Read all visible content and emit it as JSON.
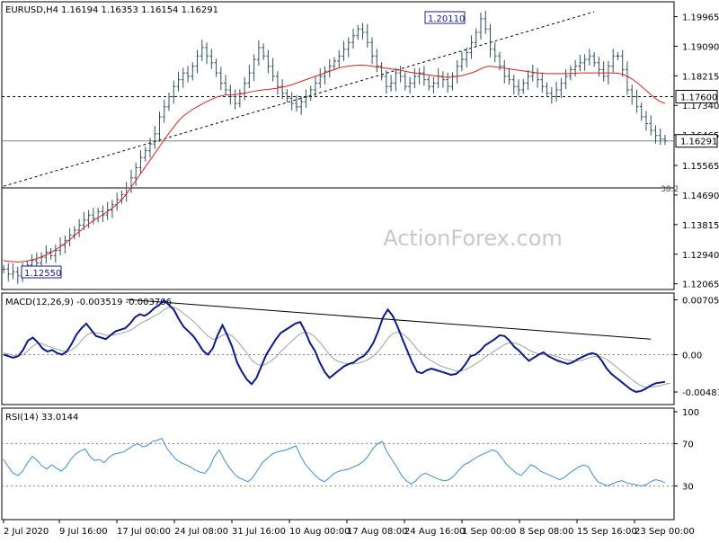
{
  "header": {
    "symbol": "EURUSD,H4",
    "ohlc": "1.16194 1.16353 1.16154 1.16291"
  },
  "watermark": "ActionForex.com",
  "colors": {
    "price_bars": "#2f4f5f",
    "ma": "#e0201b",
    "macd": "#0b1a8a",
    "signal": "#a0a0a0",
    "rsi": "#3a8ed6",
    "label_border": "#1a1a9a",
    "grid": "#808080"
  },
  "annotations": {
    "high_label": "1.20110",
    "low_label": "1.12550",
    "fib_label": "38.2"
  },
  "chart_data": [
    {
      "type": "ohlc",
      "panel": "price",
      "y_ticks": [
        "1.19965",
        "1.19090",
        "1.18215",
        "1.17340",
        "1.16465",
        "1.15565",
        "1.14690",
        "1.13815",
        "1.12940",
        "1.12065"
      ],
      "ylim": [
        1.1195,
        1.2035
      ],
      "highlight_labels": [
        {
          "text": "1.17600",
          "value": 1.176
        },
        {
          "text": "1.16291",
          "value": 1.16291
        }
      ],
      "horizontal_lines": [
        {
          "value": 1.176,
          "style": "dashed"
        },
        {
          "value": 1.16291,
          "style": "solid-gray"
        },
        {
          "value": 1.149,
          "style": "solid",
          "label": "38.2"
        }
      ],
      "trendline": {
        "from": [
          0,
          1.1495
        ],
        "to": [
          125,
          1.2011
        ],
        "style": "dashed"
      },
      "closes": [
        1.125,
        1.1235,
        1.1242,
        1.123,
        1.1248,
        1.1262,
        1.1275,
        1.1268,
        1.1285,
        1.13,
        1.129,
        1.1305,
        1.132,
        1.1335,
        1.135,
        1.1365,
        1.138,
        1.1395,
        1.141,
        1.14,
        1.142,
        1.141,
        1.1425,
        1.144,
        1.1455,
        1.147,
        1.149,
        1.152,
        1.155,
        1.158,
        1.16,
        1.162,
        1.165,
        1.17,
        1.173,
        1.176,
        1.179,
        1.181,
        1.183,
        1.182,
        1.185,
        1.188,
        1.1905,
        1.188,
        1.186,
        1.183,
        1.18,
        1.178,
        1.176,
        1.174,
        1.177,
        1.18,
        1.183,
        1.187,
        1.1905,
        1.188,
        1.185,
        1.182,
        1.179,
        1.177,
        1.1755,
        1.174,
        1.173,
        1.1745,
        1.176,
        1.178,
        1.18,
        1.182,
        1.1835,
        1.185,
        1.1865,
        1.188,
        1.19,
        1.192,
        1.194,
        1.196,
        1.195,
        1.192,
        1.188,
        1.185,
        1.182,
        1.179,
        1.18,
        1.183,
        1.182,
        1.179,
        1.18,
        1.182,
        1.183,
        1.181,
        1.179,
        1.18,
        1.182,
        1.181,
        1.179,
        1.182,
        1.185,
        1.187,
        1.189,
        1.192,
        1.195,
        1.199,
        1.196,
        1.19,
        1.188,
        1.185,
        1.182,
        1.181,
        1.179,
        1.178,
        1.18,
        1.182,
        1.183,
        1.181,
        1.179,
        1.177,
        1.176,
        1.178,
        1.18,
        1.182,
        1.184,
        1.185,
        1.186,
        1.187,
        1.188,
        1.186,
        1.184,
        1.182,
        1.185,
        1.188,
        1.188,
        1.184,
        1.178,
        1.176,
        1.173,
        1.17,
        1.168,
        1.166,
        1.1645,
        1.1635,
        1.1629
      ],
      "ma_closes": [
        1.1275,
        1.1273,
        1.1272,
        1.1271,
        1.1272,
        1.1274,
        1.1277,
        1.1281,
        1.1286,
        1.1292,
        1.1299,
        1.1307,
        1.1316,
        1.1326,
        1.1337,
        1.1349,
        1.1361,
        1.1372,
        1.1383,
        1.1393,
        1.1402,
        1.1411,
        1.142,
        1.143,
        1.1441,
        1.1455,
        1.1472,
        1.1492,
        1.1512,
        1.1532,
        1.1552,
        1.1572,
        1.1592,
        1.1612,
        1.1632,
        1.1652,
        1.167,
        1.1688,
        1.1702,
        1.1712,
        1.1722,
        1.173,
        1.1738,
        1.1745,
        1.1752,
        1.1758,
        1.1762,
        1.1765,
        1.1765,
        1.1766,
        1.1768,
        1.177,
        1.1773,
        1.1776,
        1.1778,
        1.178,
        1.1781,
        1.1783,
        1.1785,
        1.1788,
        1.1791,
        1.1795,
        1.18,
        1.1805,
        1.181,
        1.1815,
        1.182,
        1.1825,
        1.183,
        1.1835,
        1.184,
        1.1845,
        1.1848,
        1.185,
        1.1852,
        1.1853,
        1.1853,
        1.1852,
        1.185,
        1.1848,
        1.1846,
        1.1844,
        1.1842,
        1.184,
        1.1838,
        1.1835,
        1.1832,
        1.183,
        1.1828,
        1.1826,
        1.1824,
        1.1822,
        1.182,
        1.1818,
        1.1817,
        1.1818,
        1.182,
        1.1822,
        1.1826,
        1.183,
        1.1835,
        1.1842,
        1.1848,
        1.185,
        1.1848,
        1.1846,
        1.1844,
        1.1842,
        1.184,
        1.1838,
        1.1836,
        1.1834,
        1.1832,
        1.183,
        1.1829,
        1.1828,
        1.1828,
        1.1828,
        1.1828,
        1.1828,
        1.1828,
        1.1829,
        1.183,
        1.183,
        1.183,
        1.183,
        1.183,
        1.183,
        1.183,
        1.183,
        1.1829,
        1.1826,
        1.182,
        1.1812,
        1.1802,
        1.179,
        1.1778,
        1.1766,
        1.1754,
        1.1745,
        1.174
      ]
    },
    {
      "type": "line",
      "panel": "macd",
      "title": "MACD(12,26,9) -0.003519 -0.003706",
      "y_ticks": [
        {
          "text": "0.007057",
          "value": 0.007057
        },
        {
          "text": "0.00",
          "value": 0.0
        },
        {
          "text": "-0.004818",
          "value": -0.004818
        }
      ],
      "ylim": [
        -0.0062,
        0.0077
      ],
      "trendline": {
        "from": [
          26,
          0.0071
        ],
        "to": [
          137,
          0.002
        ]
      },
      "series": [
        {
          "values": [
            0.0,
            -0.0002,
            -0.0004,
            -0.0002,
            0.0006,
            0.0018,
            0.0022,
            0.0016,
            0.0008,
            0.0004,
            0.0006,
            0.0002,
            0.0,
            0.0004,
            0.0014,
            0.0026,
            0.0034,
            0.004,
            0.0032,
            0.0024,
            0.0022,
            0.002,
            0.0025,
            0.003,
            0.0032,
            0.0034,
            0.004,
            0.0048,
            0.0052,
            0.005,
            0.0054,
            0.006,
            0.0064,
            0.007,
            0.0064,
            0.0058,
            0.0046,
            0.0036,
            0.003,
            0.0024,
            0.0015,
            0.0005,
            0.0,
            0.0008,
            0.0025,
            0.0038,
            0.0025,
            0.001,
            -0.001,
            -0.0022,
            -0.0032,
            -0.0038,
            -0.003,
            -0.0015,
            0.0,
            0.001,
            0.002,
            0.0028,
            0.0032,
            0.0036,
            0.004,
            0.0042,
            0.003,
            0.0015,
            0.0005,
            -0.001,
            -0.0022,
            -0.003,
            -0.0025,
            -0.002,
            -0.0015,
            -0.0012,
            -0.001,
            -0.0005,
            -0.0002,
            0.0005,
            0.0015,
            0.003,
            0.0048,
            0.0058,
            0.005,
            0.0036,
            0.002,
            0.0005,
            -0.001,
            -0.0022,
            -0.0024,
            -0.002,
            -0.0018,
            -0.002,
            -0.0022,
            -0.0024,
            -0.0026,
            -0.0025,
            -0.002,
            -0.0012,
            -0.0002,
            0.0,
            0.0005,
            0.0012,
            0.0016,
            0.002,
            0.0025,
            0.0024,
            0.0018,
            0.001,
            0.0005,
            -0.0002,
            -0.0008,
            -0.0004,
            0.0,
            0.0003,
            -0.0002,
            -0.0005,
            -0.0008,
            -0.001,
            -0.0012,
            -0.001,
            -0.0006,
            -0.0003,
            0.0,
            0.0002,
            0.0,
            -0.0008,
            -0.0018,
            -0.0025,
            -0.003,
            -0.0035,
            -0.004,
            -0.0045,
            -0.0048,
            -0.0047,
            -0.0044,
            -0.004,
            -0.0037,
            -0.0036,
            -0.0035
          ]
        },
        {
          "values": [
            0.0002,
            0.0001,
            -0.0001,
            -0.0002,
            0.0,
            0.0005,
            0.0011,
            0.0015,
            0.0014,
            0.0011,
            0.0009,
            0.0007,
            0.0005,
            0.0004,
            0.0006,
            0.0011,
            0.0018,
            0.0025,
            0.0028,
            0.0028,
            0.0027,
            0.0025,
            0.0025,
            0.0026,
            0.0027,
            0.0029,
            0.0031,
            0.0035,
            0.004,
            0.0043,
            0.0046,
            0.005,
            0.0053,
            0.0058,
            0.0061,
            0.0061,
            0.0058,
            0.0053,
            0.0048,
            0.0043,
            0.0037,
            0.003,
            0.0024,
            0.002,
            0.0021,
            0.0025,
            0.0027,
            0.0024,
            0.0018,
            0.001,
            0.0002,
            -0.0007,
            -0.0012,
            -0.0014,
            -0.0012,
            -0.0008,
            -0.0003,
            0.0004,
            0.001,
            0.0016,
            0.0022,
            0.0027,
            0.0029,
            0.0027,
            0.0023,
            0.0016,
            0.0008,
            0.0,
            -0.0006,
            -0.0009,
            -0.0011,
            -0.0012,
            -0.0012,
            -0.0011,
            -0.0009,
            -0.0006,
            -0.0002,
            0.0004,
            0.0012,
            0.0021,
            0.0027,
            0.0029,
            0.0027,
            0.0022,
            0.0015,
            0.0007,
            0.0001,
            -0.0004,
            -0.0008,
            -0.0012,
            -0.0015,
            -0.0017,
            -0.0019,
            -0.0021,
            -0.0021,
            -0.0019,
            -0.0016,
            -0.0012,
            -0.0008,
            -0.0003,
            0.0001,
            0.0005,
            0.0009,
            0.0013,
            0.0015,
            0.0015,
            0.0013,
            0.001,
            0.0006,
            0.0003,
            0.0001,
            0.0,
            0.0,
            -0.0001,
            -0.0003,
            -0.0005,
            -0.0007,
            -0.0008,
            -0.0008,
            -0.0007,
            -0.0005,
            -0.0003,
            -0.0002,
            -0.0003,
            -0.0006,
            -0.0011,
            -0.0016,
            -0.0021,
            -0.0026,
            -0.0031,
            -0.0036,
            -0.004,
            -0.0042,
            -0.0042,
            -0.0041,
            -0.004,
            -0.0038,
            -0.0037
          ]
        }
      ]
    },
    {
      "type": "line",
      "panel": "rsi",
      "title": "RSI(14) 33.0144",
      "y_ticks": [
        {
          "text": "100",
          "value": 100
        },
        {
          "text": "70",
          "value": 70
        },
        {
          "text": "30",
          "value": 30
        }
      ],
      "ylim": [
        0,
        100
      ],
      "values": [
        55,
        48,
        42,
        40,
        44,
        52,
        58,
        54,
        49,
        46,
        50,
        47,
        44,
        48,
        55,
        60,
        63,
        65,
        58,
        54,
        55,
        52,
        57,
        60,
        61,
        62,
        65,
        68,
        70,
        67,
        68,
        72,
        73,
        75,
        66,
        60,
        55,
        52,
        50,
        48,
        45,
        43,
        42,
        48,
        58,
        64,
        55,
        48,
        42,
        38,
        36,
        34,
        38,
        45,
        52,
        56,
        60,
        62,
        63,
        64,
        66,
        68,
        58,
        50,
        45,
        40,
        36,
        34,
        38,
        42,
        44,
        45,
        46,
        48,
        50,
        53,
        58,
        65,
        70,
        72,
        62,
        55,
        48,
        40,
        35,
        32,
        35,
        40,
        42,
        40,
        38,
        36,
        35,
        36,
        40,
        45,
        50,
        52,
        55,
        58,
        60,
        62,
        64,
        62,
        56,
        50,
        46,
        42,
        40,
        45,
        50,
        48,
        44,
        42,
        40,
        38,
        36,
        38,
        42,
        45,
        48,
        50,
        48,
        40,
        34,
        32,
        30,
        32,
        34,
        35,
        33,
        32,
        31,
        30,
        31,
        34,
        36,
        35,
        33
      ]
    }
  ],
  "x_axis": {
    "labels": [
      "2 Jul 2020",
      "9 Jul 16:00",
      "17 Jul 00:00",
      "24 Jul 08:00",
      "31 Jul 16:00",
      "10 Aug 00:00",
      "17 Aug 08:00",
      "24 Aug 16:00",
      "1 Sep 00:00",
      "8 Sep 08:00",
      "15 Sep 16:00",
      "23 Sep 00:00"
    ]
  }
}
